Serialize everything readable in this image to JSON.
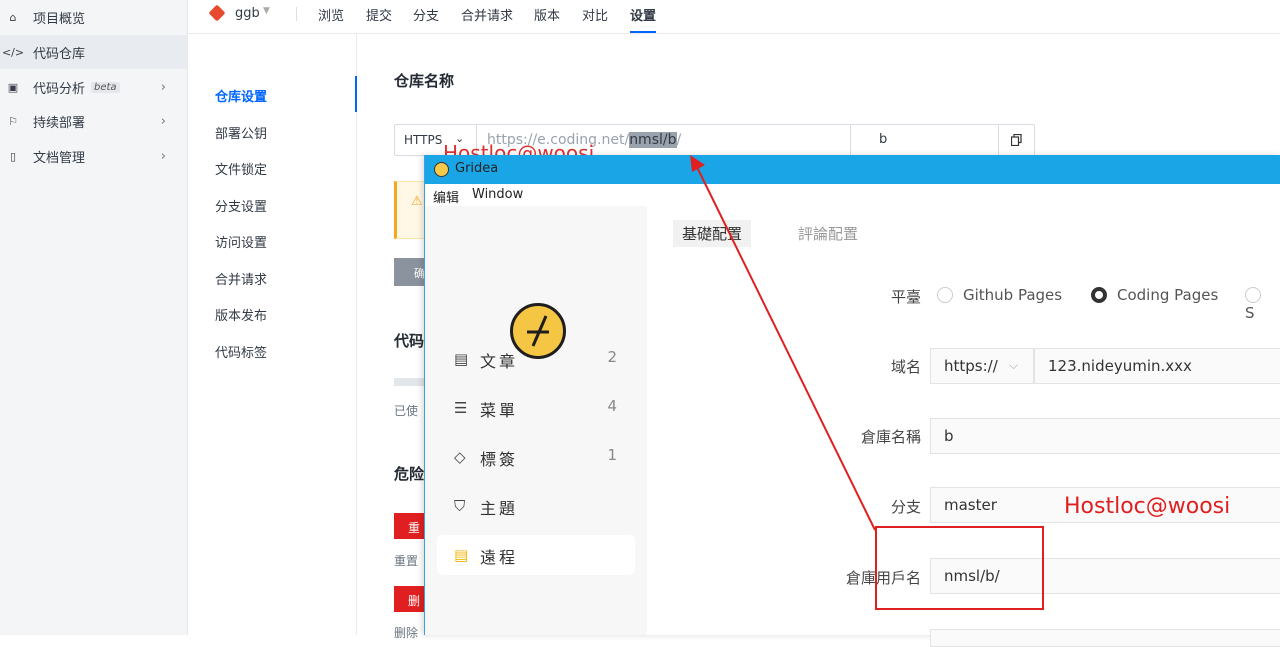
{
  "sidebar": {
    "items": [
      {
        "label": "项目概览",
        "icon": "home-icon",
        "glyph": "⌂"
      },
      {
        "label": "代码仓库",
        "icon": "code-icon",
        "glyph": "</>",
        "active": true
      },
      {
        "label": "代码分析",
        "icon": "terminal-icon",
        "glyph": "▣",
        "badge": "beta",
        "chevron": "›"
      },
      {
        "label": "持续部署",
        "icon": "rocket-icon",
        "glyph": "⚐",
        "chevron": "›"
      },
      {
        "label": "文档管理",
        "icon": "document-icon",
        "glyph": "▯",
        "chevron": "›"
      }
    ]
  },
  "header": {
    "repo": "ggb",
    "tabs": [
      "浏览",
      "提交",
      "分支",
      "合并请求",
      "版本",
      "对比",
      "设置"
    ],
    "active_tab": "设置"
  },
  "settings_nav": {
    "items": [
      "仓库设置",
      "部署公钥",
      "文件锁定",
      "分支设置",
      "访问设置",
      "合并请求",
      "版本发布",
      "代码标签"
    ],
    "active": "仓库设置"
  },
  "repo_settings": {
    "title": "仓库名称",
    "protocol": "HTTPS",
    "url_prefix": "https://e.coding.net/",
    "url_highlight": "nmsl/b",
    "url_suffix": "/",
    "repo_name": "b",
    "button_partial": "确",
    "section2_partial": "代码",
    "usage_partial": "已使",
    "danger_partial": "危险",
    "reset_btn_partial": "重",
    "reset_note_partial": "重置",
    "delete_btn_partial": "删",
    "delete_note_partial": "删除"
  },
  "watermark": "Hostloc@woosi",
  "gridea": {
    "title": "Gridea",
    "menu": [
      "编辑",
      "Window"
    ],
    "nav": [
      {
        "label": "文章",
        "count": "2",
        "icon": "article-icon",
        "glyph": "▤"
      },
      {
        "label": "菜單",
        "count": "4",
        "icon": "menu-icon",
        "glyph": "☰"
      },
      {
        "label": "標簽",
        "count": "1",
        "icon": "tag-icon",
        "glyph": "◇"
      },
      {
        "label": "主題",
        "count": "",
        "icon": "theme-icon",
        "glyph": "⛉"
      },
      {
        "label": "遠程",
        "count": "",
        "icon": "remote-icon",
        "glyph": "▤",
        "active": true
      }
    ],
    "tabs": [
      "基礎配置",
      "評論配置"
    ],
    "form": {
      "platform_label": "平臺",
      "platforms": [
        "Github Pages",
        "Coding Pages",
        "S"
      ],
      "selected_platform": "Coding Pages",
      "domain_label": "域名",
      "domain_protocol": "https://",
      "domain_value": "123.nideyumin.xxx",
      "repo_label": "倉庫名稱",
      "repo_value": "b",
      "branch_label": "分支",
      "branch_value": "master",
      "user_label": "倉庫用戶名",
      "user_value": "nmsl/b/"
    }
  },
  "annotation": {
    "text": "Hostloc@woosi",
    "color": "#e02020"
  }
}
